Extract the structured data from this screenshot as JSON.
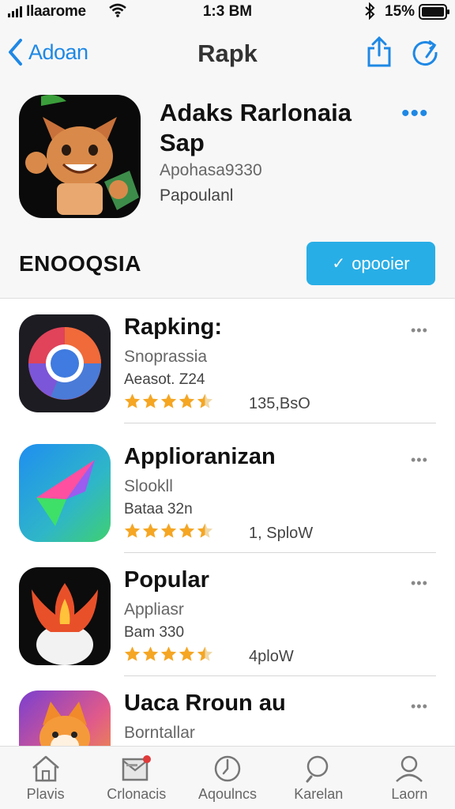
{
  "status": {
    "carrier": "Ilaarome",
    "time": "1:3 BM",
    "battery": "15%"
  },
  "nav": {
    "back_label": "Adoan",
    "title": "Rapk"
  },
  "hero": {
    "name_line1": "Adaks Rarlonaia",
    "name_line2": "Sap",
    "sub1": "Apohasa9330",
    "sub2": "Papoulanl",
    "section_title": "ENOOQSIA",
    "button_label": "opooier",
    "more_label": "•••"
  },
  "apps": [
    {
      "name": "Rapking:",
      "sub1": "Snoprassia",
      "sub2": "Aeasot. Z24",
      "count": "135,BsO",
      "rating": 4.5,
      "more": "•••"
    },
    {
      "name": "Applioranizan",
      "sub1": "Slookll",
      "sub2": "Bataa 32n",
      "count": "1, SploW",
      "rating": 4.5,
      "more": "•••"
    },
    {
      "name": "Popular",
      "sub1": "Appliasr",
      "sub2": "Bam 330",
      "count": "4ploW",
      "rating": 4.5,
      "more": "•••"
    },
    {
      "name": "Uaca Rroun au",
      "sub1": "Borntallar",
      "sub2": "",
      "count": "",
      "rating": null,
      "more": "•••"
    }
  ],
  "tabs": [
    {
      "label": "Plavis",
      "icon": "home-icon"
    },
    {
      "label": "Crlonacis",
      "icon": "mail-icon"
    },
    {
      "label": "Aqoulncs",
      "icon": "clock-icon"
    },
    {
      "label": "Karelan",
      "icon": "search-icon"
    },
    {
      "label": "Laorn",
      "icon": "person-icon"
    }
  ],
  "colors": {
    "accent": "#1e88e5",
    "button": "#28aee6",
    "star": "#f5a623"
  }
}
